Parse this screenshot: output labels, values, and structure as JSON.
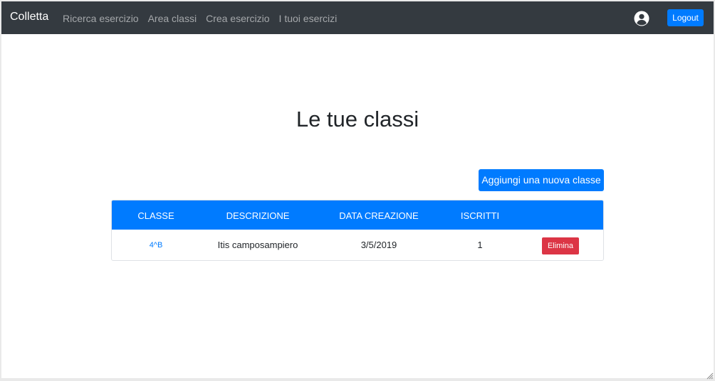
{
  "navbar": {
    "brand": "Colletta",
    "links": [
      {
        "label": "Ricerca esercizio"
      },
      {
        "label": "Area classi"
      },
      {
        "label": "Crea esercizio"
      },
      {
        "label": "I tuoi esercizi"
      }
    ],
    "user_icon": "user-circle-icon",
    "logout_label": "Logout"
  },
  "page": {
    "title": "Le tue classi",
    "add_button_label": "Aggiungi una nuova classe"
  },
  "table": {
    "headers": [
      "CLASSE",
      "DESCRIZIONE",
      "DATA CREAZIONE",
      "ISCRITTI"
    ],
    "rows": [
      {
        "classe": "4^B",
        "descrizione": "Itis camposampiero",
        "data_creazione": "3/5/2019",
        "iscritti": "1",
        "delete_label": "Elimina"
      }
    ]
  },
  "colors": {
    "navbar_bg": "#343a40",
    "primary": "#007bff",
    "danger": "#dc3545"
  }
}
